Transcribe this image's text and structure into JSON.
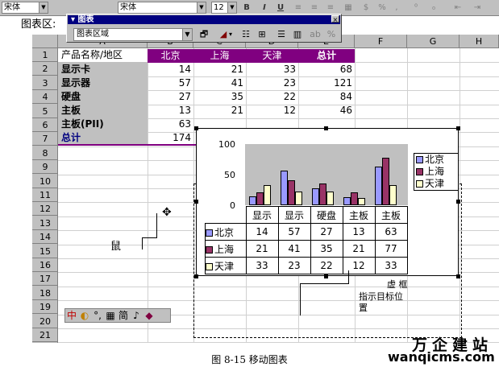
{
  "format_toolbar": {
    "font_name": "宋体",
    "font_name2": "宋体",
    "font_size": "12",
    "bold": "B",
    "italic": "I",
    "underline": "U",
    "percent": "%",
    "comma": ","
  },
  "name_box": "图表区:",
  "chart_toolbar": {
    "title": "图表",
    "close": "×",
    "object_select": "图表区域"
  },
  "columns": [
    "A",
    "B",
    "C",
    "D",
    "E",
    "F",
    "G",
    "H"
  ],
  "rows": [
    "1",
    "2",
    "3",
    "4",
    "5",
    "6",
    "7",
    "8",
    "9",
    "10",
    "11",
    "12",
    "13",
    "14",
    "15",
    "16",
    "17",
    "18",
    "19",
    "20",
    "21"
  ],
  "table": {
    "header": [
      "产品名称/地区",
      "北京",
      "上海",
      "天津",
      "总计"
    ],
    "rows": [
      {
        "name": "显示卡",
        "v": [
          "14",
          "21",
          "33",
          "68"
        ]
      },
      {
        "name": "显示器",
        "v": [
          "57",
          "41",
          "23",
          "121"
        ]
      },
      {
        "name": "硬盘",
        "v": [
          "27",
          "35",
          "22",
          "84"
        ]
      },
      {
        "name": "主板",
        "v": [
          "13",
          "21",
          "12",
          "46"
        ]
      },
      {
        "name": "主板(PII)",
        "v": [
          "63",
          "",
          "",
          ""
        ]
      },
      {
        "name": "总计",
        "v": [
          "174",
          "",
          "",
          ""
        ]
      }
    ]
  },
  "chart_data": {
    "type": "bar",
    "categories": [
      "显示",
      "显示",
      "硬盘",
      "主板",
      "主板"
    ],
    "series": [
      {
        "name": "北京",
        "values": [
          14,
          57,
          27,
          13,
          63
        ],
        "color": "#9999ff"
      },
      {
        "name": "上海",
        "values": [
          21,
          41,
          35,
          21,
          77
        ],
        "color": "#993366"
      },
      {
        "name": "天津",
        "values": [
          33,
          23,
          22,
          12,
          33
        ],
        "color": "#ffffcc"
      }
    ],
    "yticks": [
      "100",
      "50",
      "0"
    ],
    "ylim": [
      0,
      100
    ],
    "data_table": true,
    "legend": "right",
    "plot_bg": "#c0c0c0"
  },
  "annotations": {
    "mouse": "鼠",
    "box1": "虚  框",
    "box2": "指示目标位",
    "box3": "置"
  },
  "ime_bar": [
    "中",
    "◐",
    "°,",
    "▦",
    "简",
    "♪",
    "◆"
  ],
  "caption": "图 8-15  移动图表",
  "watermark": {
    "line1": "万企建站",
    "line2": "wanqicms.com"
  }
}
